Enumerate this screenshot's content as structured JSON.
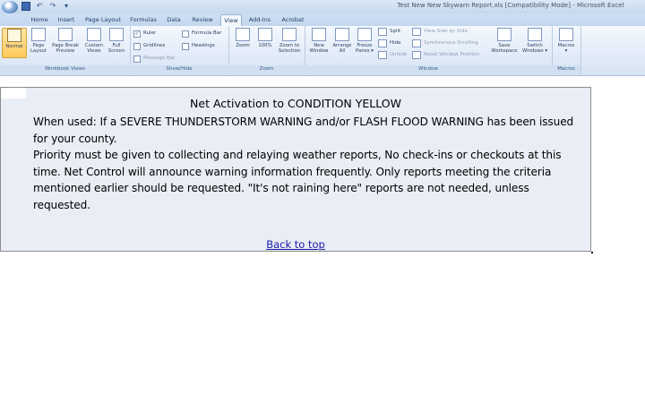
{
  "titlebar": {
    "title": "Test New New Skywarn Report.xls [Compatibility Mode] - Microsoft Excel",
    "qat_save_icon": "save-icon",
    "qat_undo_glyph": "↶",
    "qat_redo_glyph": "↷",
    "qat_more_glyph": "▾"
  },
  "tabs": [
    "Home",
    "Insert",
    "Page Layout",
    "Formulas",
    "Data",
    "Review",
    "View",
    "Add-Ins",
    "Acrobat"
  ],
  "active_tab": "View",
  "ribbon": {
    "workbook_views": {
      "label": "Workbook Views",
      "normal": "Normal",
      "page_layout": [
        "Page",
        "Layout"
      ],
      "page_break": [
        "Page Break",
        "Preview"
      ],
      "custom_views": [
        "Custom",
        "Views"
      ],
      "full_screen": [
        "Full",
        "Screen"
      ]
    },
    "show_hide": {
      "label": "Show/Hide",
      "ruler": "Ruler",
      "gridlines": "Gridlines",
      "message_bar": "Message Bar",
      "formula_bar": "Formula Bar",
      "headings": "Headings"
    },
    "zoom": {
      "label": "Zoom",
      "zoom": "Zoom",
      "hundred": "100%",
      "selection": [
        "Zoom to",
        "Selection"
      ]
    },
    "window": {
      "label": "Window",
      "new_window": [
        "New",
        "Window"
      ],
      "arrange_all": [
        "Arrange",
        "All"
      ],
      "freeze_panes": [
        "Freeze",
        "Panes ▾"
      ],
      "split": "Split",
      "hide": "Hide",
      "unhide": "Unhide",
      "side_by_side": "View Side by Side",
      "sync_scroll": "Synchronous Scrolling",
      "reset_position": "Reset Window Position",
      "save_workspace": [
        "Save",
        "Workspace"
      ],
      "switch_windows": [
        "Switch",
        "Windows ▾"
      ]
    },
    "macros": {
      "label": "Macros",
      "macros": [
        "Macros",
        "▾"
      ]
    }
  },
  "content": {
    "heading": "Net Activation to CONDITION YELLOW",
    "when_used": "When used: If a SEVERE THUNDERSTORM WARNING and/or FLASH FLOOD WARNING has been issued for your county.",
    "priority": "Priority must be given to collecting and relaying weather reports, No check-ins or checkouts at this time. Net Control will announce warning information frequently. Only reports meeting the criteria mentioned earlier should be requested. \"It's not raining here\" reports are not needed, unless requested.",
    "back_link": "Back to top"
  }
}
